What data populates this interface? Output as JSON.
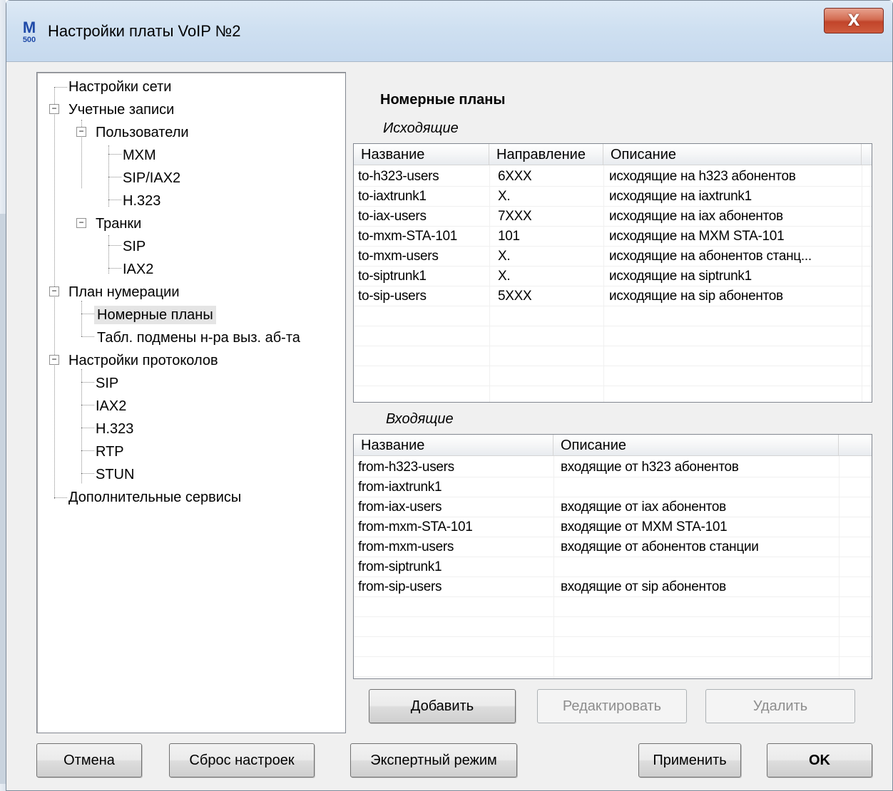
{
  "window": {
    "title": "Настройки платы VoIP №2",
    "icon_top": "M",
    "icon_bottom": "500",
    "close_label": "X"
  },
  "tree": {
    "items": [
      {
        "label": "Настройки сети"
      },
      {
        "label": "Учетные записи"
      },
      {
        "label": "Пользователи"
      },
      {
        "label": "MXM"
      },
      {
        "label": "SIP/IAX2"
      },
      {
        "label": "H.323"
      },
      {
        "label": "Транки"
      },
      {
        "label": "SIP"
      },
      {
        "label": "IAX2"
      },
      {
        "label": "План нумерации"
      },
      {
        "label": "Номерные планы"
      },
      {
        "label": "Табл. подмены н-ра выз. аб-та"
      },
      {
        "label": "Настройки протоколов"
      },
      {
        "label": "SIP"
      },
      {
        "label": "IAX2"
      },
      {
        "label": "H.323"
      },
      {
        "label": "RTP"
      },
      {
        "label": "STUN"
      },
      {
        "label": "Дополнительные сервисы"
      }
    ]
  },
  "main": {
    "title": "Номерные планы",
    "outgoing": {
      "label": "Исходящие",
      "columns": [
        "Название",
        "Направление",
        "Описание"
      ],
      "rows": [
        [
          "to-h323-users",
          "6XXX",
          "исходящие на h323 абонентов"
        ],
        [
          "to-iaxtrunk1",
          "X.",
          "исходящие на iaxtrunk1"
        ],
        [
          "to-iax-users",
          "7XXX",
          "исходящие на iax абонентов"
        ],
        [
          "to-mxm-STA-101",
          "101",
          "исходящие на MXM STA-101"
        ],
        [
          "to-mxm-users",
          "X.",
          "исходящие на абонентов станц..."
        ],
        [
          "to-siptrunk1",
          "X.",
          "исходящие на siptrunk1"
        ],
        [
          "to-sip-users",
          "5XXX",
          "исходящие на sip абонентов"
        ]
      ]
    },
    "incoming": {
      "label": "Входящие",
      "columns": [
        "Название",
        "Описание"
      ],
      "rows": [
        [
          "from-h323-users",
          "входящие от h323 абонентов"
        ],
        [
          "from-iaxtrunk1",
          ""
        ],
        [
          "from-iax-users",
          "входящие от iax абонентов"
        ],
        [
          "from-mxm-STA-101",
          "входящие от MXM STA-101"
        ],
        [
          "from-mxm-users",
          "входящие от абонентов станции"
        ],
        [
          "from-siptrunk1",
          ""
        ],
        [
          "from-sip-users",
          "входящие от sip абонентов"
        ]
      ]
    },
    "buttons": {
      "add": "Добавить",
      "edit": "Редактировать",
      "delete": "Удалить"
    }
  },
  "footer": {
    "cancel": "Отмена",
    "reset": "Сброс настроек",
    "expert": "Экспертный режим",
    "apply": "Применить",
    "ok": "OK"
  }
}
